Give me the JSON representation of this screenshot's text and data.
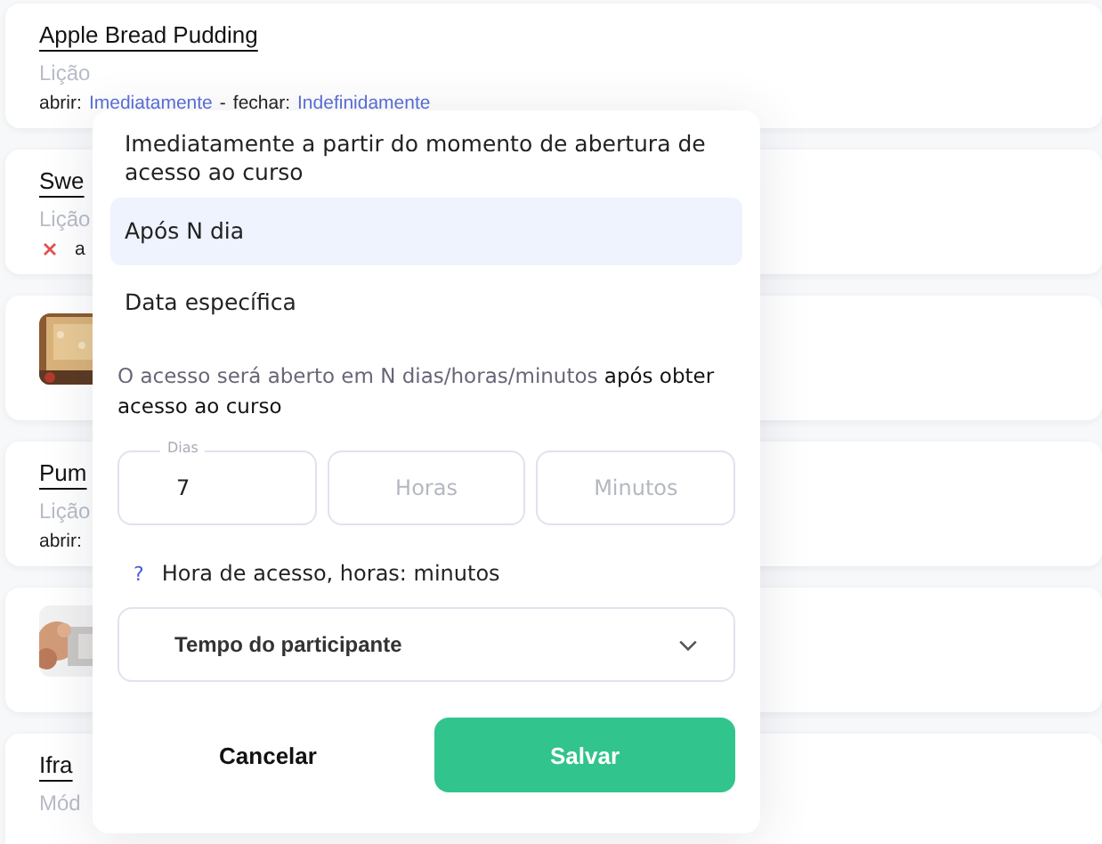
{
  "cards": [
    {
      "kind": "text",
      "title": "Apple Bread Pudding",
      "type": "Lição",
      "error": false,
      "schedule": [
        {
          "kind": "label",
          "text": "abrir:"
        },
        {
          "kind": "link",
          "text": "Imediatamente"
        },
        {
          "kind": "sep",
          "text": "-"
        },
        {
          "kind": "label",
          "text": "fechar:"
        },
        {
          "kind": "link",
          "text": "Indefinidamente"
        }
      ]
    },
    {
      "kind": "text",
      "title": "Swe",
      "type": "Lição",
      "error": true,
      "schedule": [
        {
          "kind": "label",
          "text": "a"
        }
      ]
    },
    {
      "kind": "picture"
    },
    {
      "kind": "text",
      "title": "Pum",
      "type": "Lição",
      "error": false,
      "schedule": [
        {
          "kind": "label",
          "text": "abrir:"
        }
      ]
    },
    {
      "kind": "picture"
    },
    {
      "kind": "text",
      "title": "Ifra",
      "type": "Mód",
      "error": false
    }
  ],
  "dialog": {
    "options": [
      {
        "label": "Imediatamente a partir do momento de abertura de acesso ao curso",
        "selected": false
      },
      {
        "label": "Após N dia",
        "selected": true
      },
      {
        "label": "Data específica",
        "selected": false
      }
    ],
    "description": "O acesso será aberto em N dias/horas/minutos **após obter acesso ao curso**",
    "fields": [
      {
        "label": "Dias",
        "value": "7"
      },
      {
        "placeholder": "Horas"
      },
      {
        "placeholder": "Minutos"
      }
    ],
    "help_icon": "?",
    "time_label": "Hora de acesso, horas: minutos",
    "select": {
      "value": "Tempo do participante"
    },
    "buttons": [
      {
        "kind": "text",
        "label": "Cancelar"
      },
      {
        "kind": "primary",
        "label": "Salvar"
      }
    ]
  }
}
